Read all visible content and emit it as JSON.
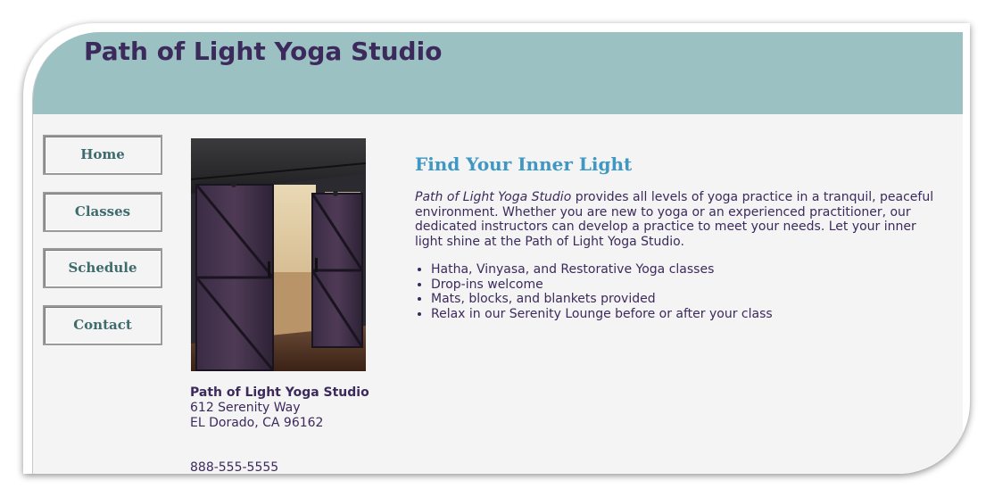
{
  "site": {
    "title": "Path of Light Yoga Studio"
  },
  "nav": {
    "items": [
      "Home",
      "Classes",
      "Schedule",
      "Contact"
    ]
  },
  "sidebar": {
    "address": {
      "name": "Path of Light Yoga Studio",
      "street": "612 Serenity Way",
      "city": "EL Dorado, CA 96162"
    },
    "phone": "888-555-5555"
  },
  "main": {
    "heading": "Find Your Inner Light",
    "intro_studio": "Path of Light Yoga Studio",
    "intro_rest": " provides all levels of yoga practice in a tranquil, peaceful environment. Whether you are new to yoga or an experienced practitioner, our dedicated instructors can develop a practice to meet your needs. Let your inner light shine at the Path of Light Yoga Studio.",
    "features": [
      "Hatha, Vinyasa, and Restorative Yoga classes",
      "Drop-ins welcome",
      "Mats, blocks, and blankets provided",
      "Relax in our Serenity Lounge before or after your class"
    ]
  },
  "colors": {
    "header_bg": "#9bc1c3",
    "title": "#3c2a5c",
    "heading": "#3f97c3",
    "nav_text": "#3e6b6d"
  }
}
